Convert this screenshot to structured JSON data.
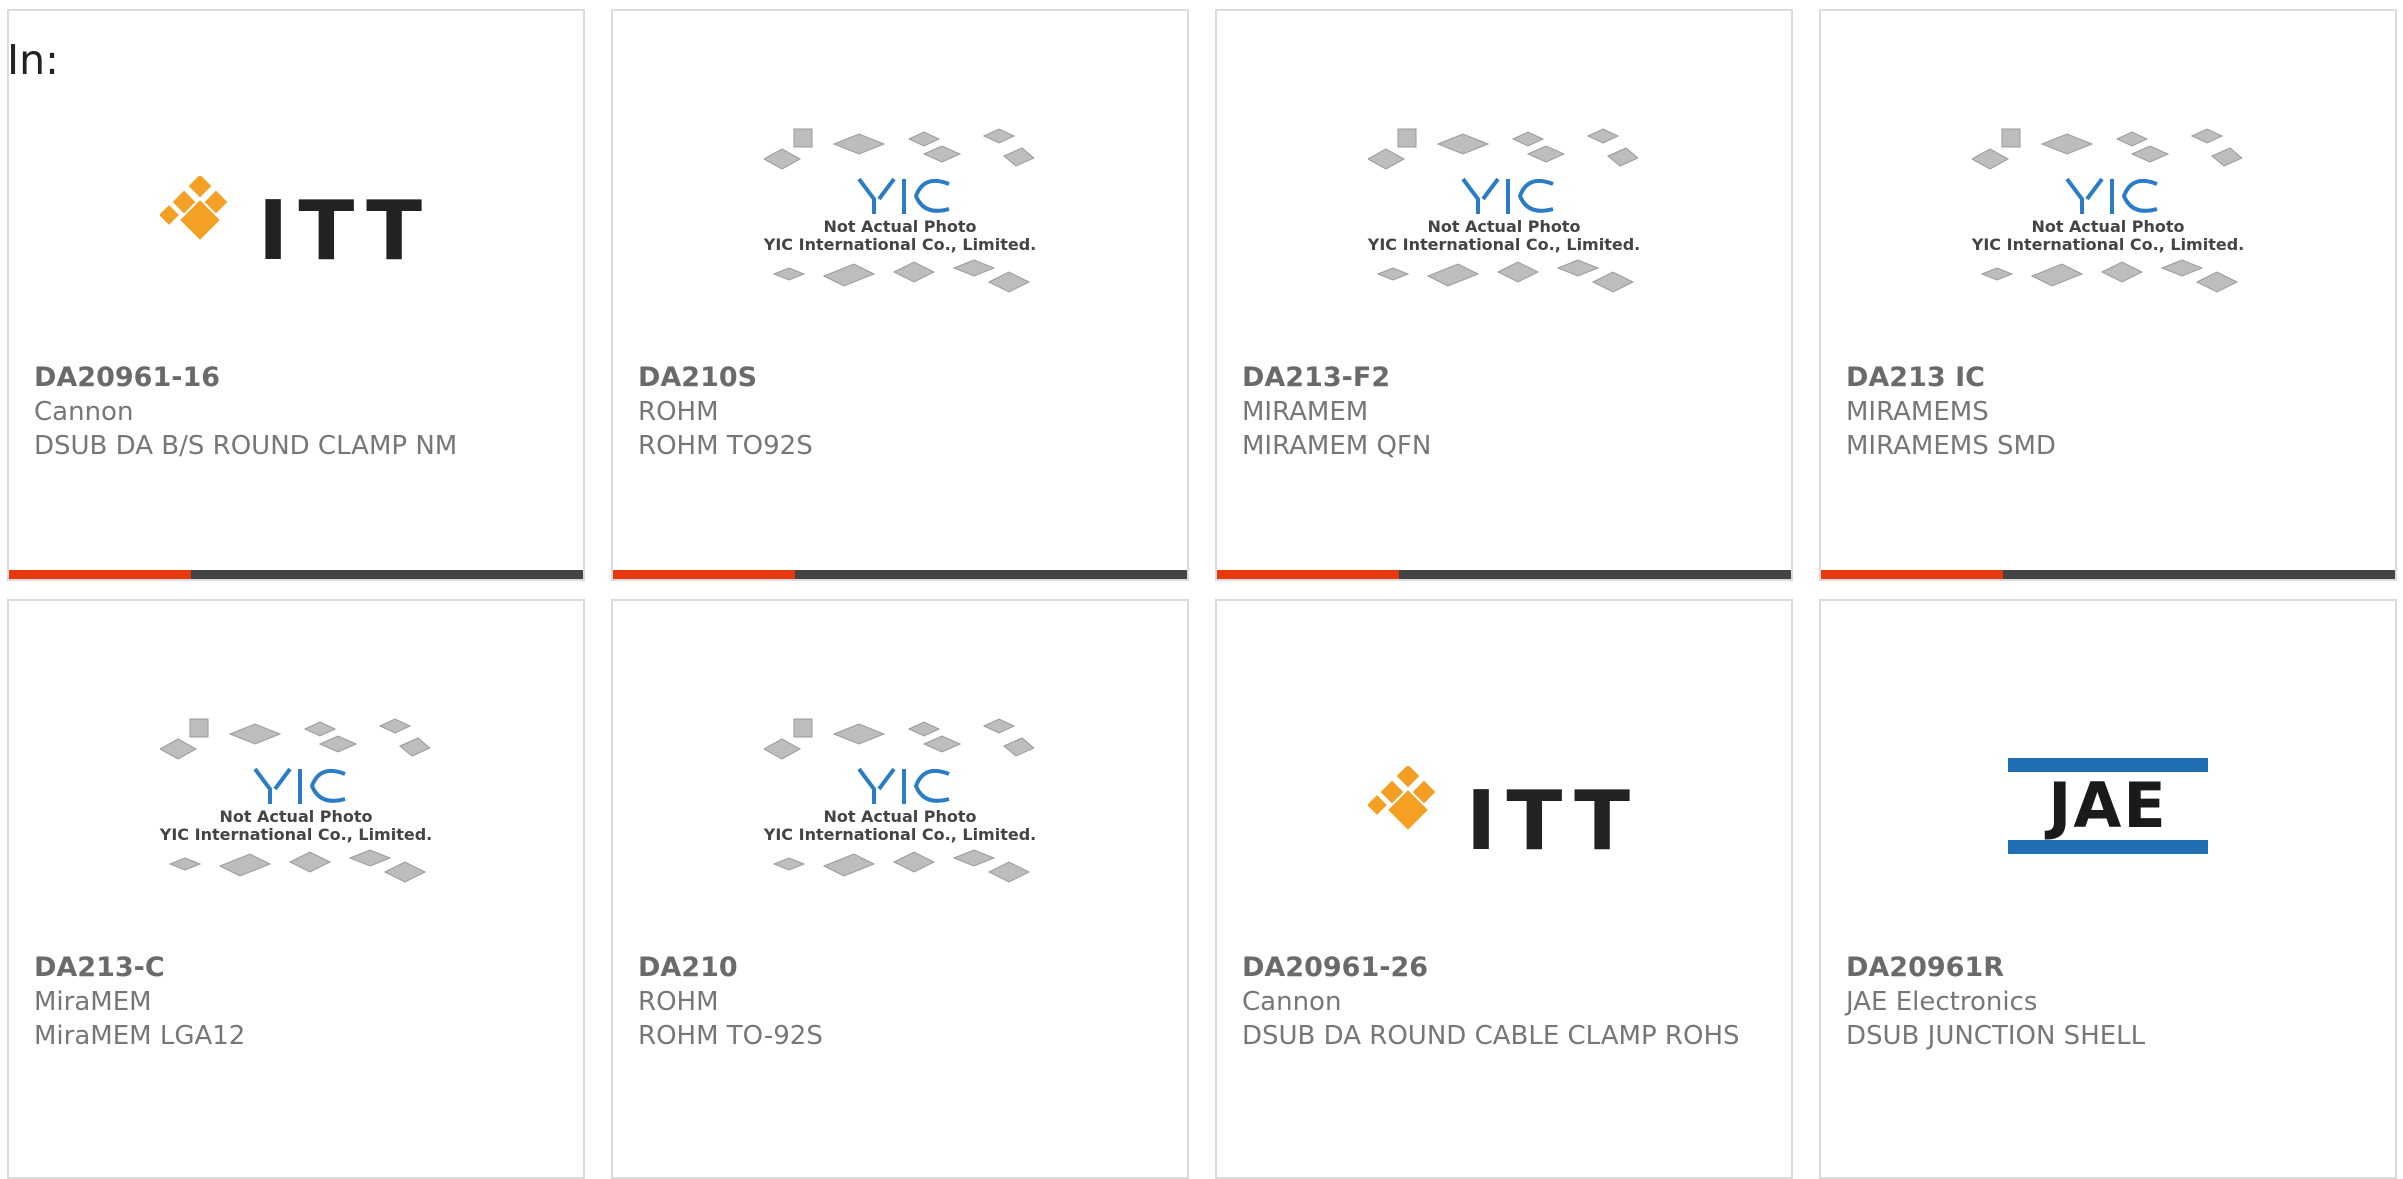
{
  "header": {
    "in_label": "In:"
  },
  "yic_caption": {
    "line1": "Not Actual Photo",
    "line2": "YIC International Co., Limited."
  },
  "cards": [
    {
      "part_number": "DA20961-16",
      "manufacturer": "Cannon",
      "description": "DSUB DA B/S ROUND CLAMP NM",
      "logo": "itt",
      "logo_text": "ITT",
      "has_bar": true
    },
    {
      "part_number": "DA210S",
      "manufacturer": "ROHM",
      "description": "ROHM TO92S",
      "logo": "yic",
      "has_bar": true
    },
    {
      "part_number": "DA213-F2",
      "manufacturer": "MIRAMEM",
      "description": "MIRAMEM QFN",
      "logo": "yic",
      "has_bar": true
    },
    {
      "part_number": "DA213 IC",
      "manufacturer": "MIRAMEMS",
      "description": "MIRAMEMS SMD",
      "logo": "yic",
      "has_bar": true
    },
    {
      "part_number": "DA213-C",
      "manufacturer": "MiraMEM",
      "description": "MiraMEM LGA12",
      "logo": "yic",
      "has_bar": false
    },
    {
      "part_number": "DA210",
      "manufacturer": "ROHM",
      "description": "ROHM TO-92S",
      "logo": "yic",
      "has_bar": false
    },
    {
      "part_number": "DA20961-26",
      "manufacturer": "Cannon",
      "description": "DSUB DA ROUND CABLE CLAMP ROHS",
      "logo": "itt",
      "logo_text": "ITT",
      "has_bar": false
    },
    {
      "part_number": "DA20961R",
      "manufacturer": "JAE Electronics",
      "description": "DSUB JUNCTION SHELL",
      "logo": "jae",
      "logo_text": "JAE",
      "has_bar": false
    }
  ],
  "colors": {
    "accent": "#e8380d",
    "bar": "#444444",
    "yic_blue": "#1f6fb2",
    "itt_orange": "#f3a024"
  }
}
